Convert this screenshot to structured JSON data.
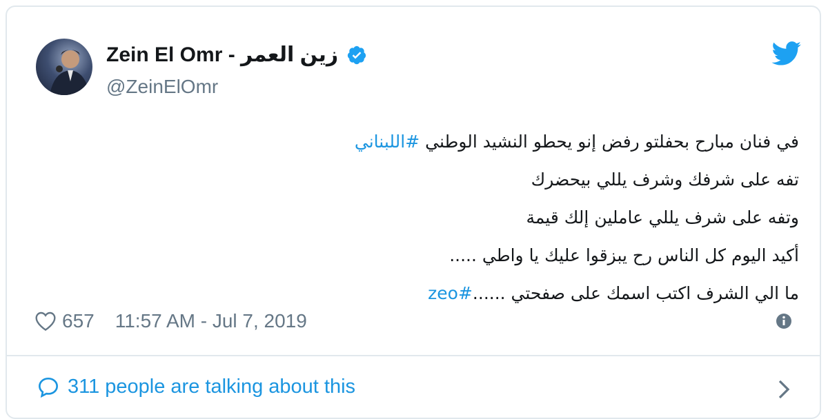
{
  "tweet": {
    "display_name": "Zein El Omr - زين العمر",
    "handle": "@ZeinElOmr",
    "lines": [
      {
        "text": "في فنان مبارح بحفلتو  رفض إنو يحطو النشيد الوطني ",
        "hashtag": "#اللبناني"
      },
      {
        "text": "تفه على شرفك وشرف يللي بيحضرك",
        "hashtag": ""
      },
      {
        "text": "وتفه على شرف يللي عاملين إلك قيمة",
        "hashtag": ""
      },
      {
        "text": "أكيد اليوم كل الناس رح يبزقوا عليك يا واطي .....",
        "hashtag": ""
      },
      {
        "text": "ما الي الشرف اكتب اسمك على صفحتي ......",
        "hashtag": "#zeo"
      }
    ],
    "likes": "657",
    "timestamp": "11:57 AM - Jul 7, 2019",
    "talking": "311 people are talking about this"
  },
  "icons": {
    "avatar": "profile-photo",
    "verified": "verified-badge-icon",
    "brand": "twitter-bird-icon",
    "like": "heart-icon",
    "info": "info-icon",
    "reply": "speech-bubble-icon",
    "more": "chevron-right-icon"
  },
  "colors": {
    "link": "#1b95e0",
    "muted": "#657786",
    "text": "#14171a",
    "border": "#e1e8ed"
  }
}
